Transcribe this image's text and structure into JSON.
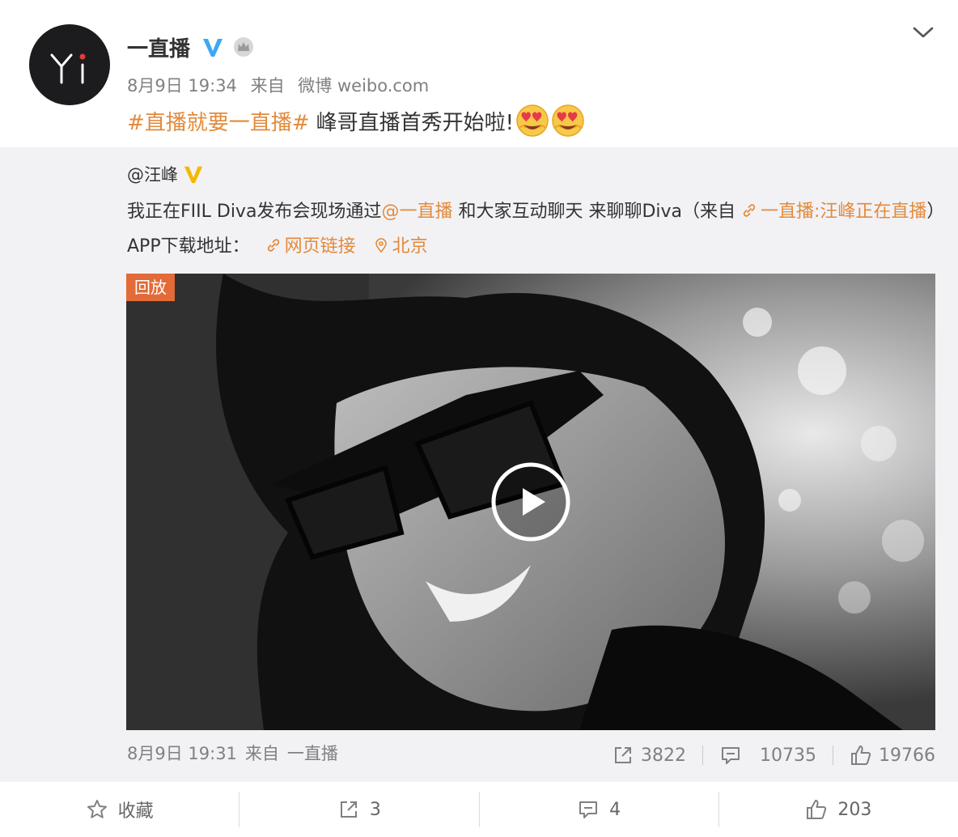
{
  "post": {
    "author": "一直播",
    "avatar_letters": "Yi",
    "time": "8月9日 19:34",
    "source_prefix": "来自",
    "source": "微博 weibo.com",
    "topic": "#直播就要一直播#",
    "text": "峰哥直播首秀开始啦!",
    "emojis": [
      "heart-eyes",
      "heart-eyes"
    ],
    "verified_color": "#3da8f5",
    "topic_color": "#e38a3a"
  },
  "repost": {
    "author": "@汪峰",
    "text_part1": "我正在FIIL Diva发布会现场通过",
    "mention": "@一直播",
    "text_part2": " 和大家互动聊天 来聊聊Diva（来自 ",
    "live_link": "一直播:汪峰正在直播",
    "text_part3": "）APP下载地址：",
    "web_link": "网页链接",
    "location": "北京",
    "badge": "回放",
    "time": "8月9日 19:31",
    "source_prefix": "来自",
    "source": "一直播",
    "reposts": "3822",
    "comments": "10735",
    "likes": "19766",
    "verified_color": "#f5b800"
  },
  "toolbar": {
    "favorite_label": "收藏",
    "share_count": "3",
    "comment_count": "4",
    "like_count": "203"
  }
}
